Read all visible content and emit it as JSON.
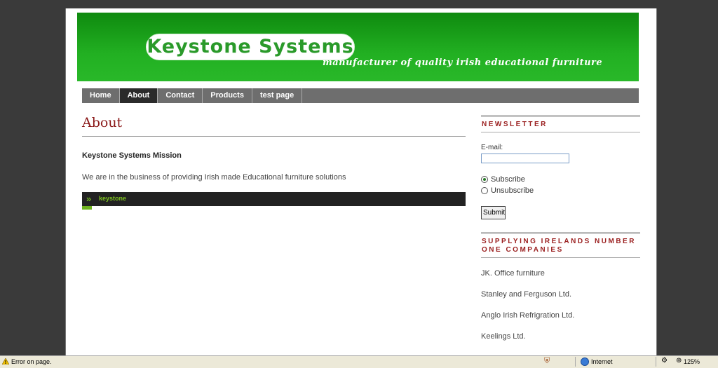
{
  "banner": {
    "logo": "Keystone Systems",
    "tagline": "manufacturer of quality irish educational furniture"
  },
  "nav": [
    "Home",
    "About",
    "Contact",
    "Products",
    "test page"
  ],
  "main": {
    "title": "About",
    "mission_heading": "Keystone Systems Mission",
    "mission_text": "We are in the business of providing Irish made Educational furniture solutions",
    "bar_label": "keystone"
  },
  "newsletter": {
    "heading": "NEWSLETTER",
    "email_label": "E-mail:",
    "email_value": "",
    "subscribe": "Subscribe",
    "unsubscribe": "Unsubscribe",
    "submit": "Submit"
  },
  "companies": {
    "heading": "SUPPLYING IRELANDS NUMBER ONE COMPANIES",
    "items": [
      "JK. Office furniture",
      "Stanley and Ferguson Ltd.",
      "Anglo Irish Refrigration Ltd.",
      "Keelings Ltd."
    ]
  },
  "status_bar": {
    "message": "Error on page.",
    "zone": "Internet",
    "zoom": "125%"
  }
}
